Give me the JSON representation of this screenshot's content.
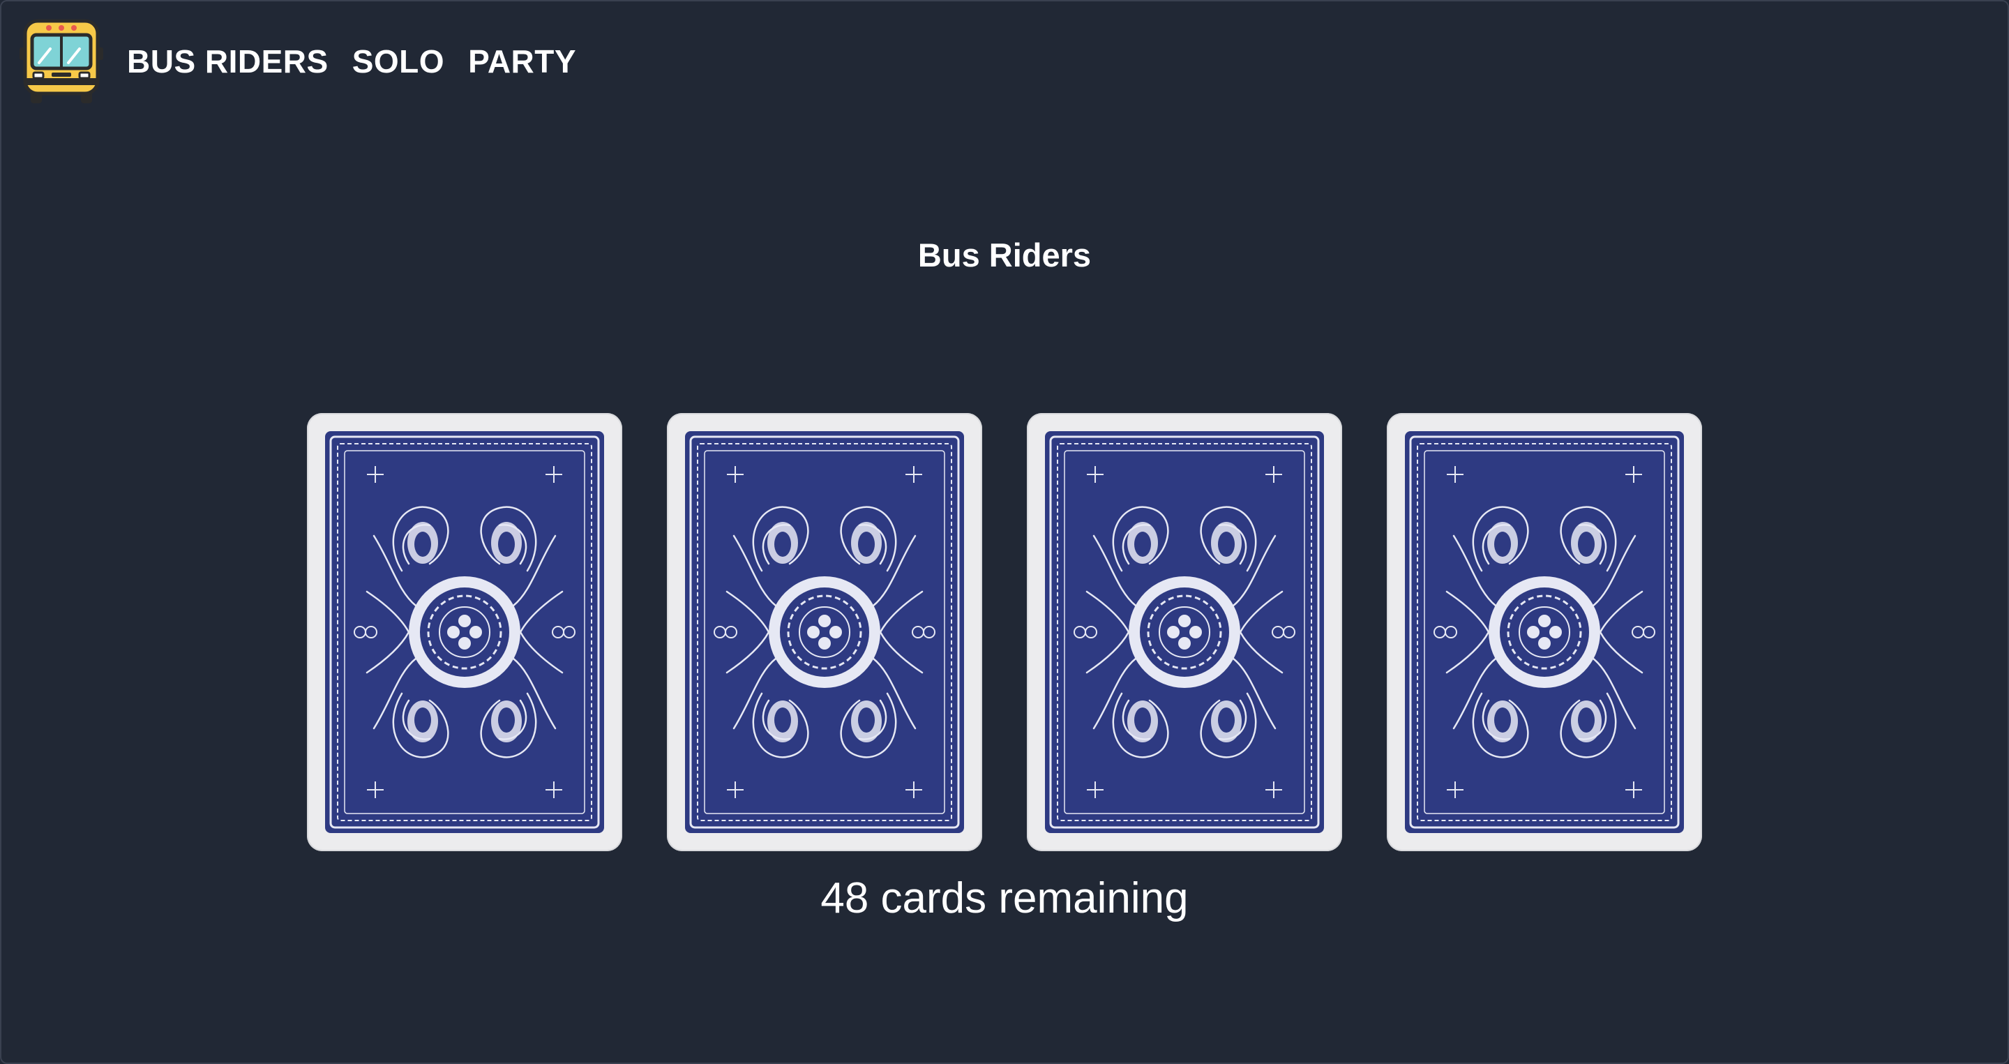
{
  "nav": {
    "logo_icon": "school-bus-icon",
    "links": [
      "BUS RIDERS",
      "SOLO",
      "PARTY"
    ]
  },
  "page": {
    "title": "Bus Riders"
  },
  "deck": {
    "card_back_icon": "card-back-pattern",
    "card_count": 4,
    "remaining_text": "48 cards remaining"
  },
  "colors": {
    "background": "#212835",
    "card_face": "#ececee",
    "card_back_blue": "#2e3a82",
    "bus_yellow": "#f7c948",
    "bus_window": "#7fd3d6"
  }
}
